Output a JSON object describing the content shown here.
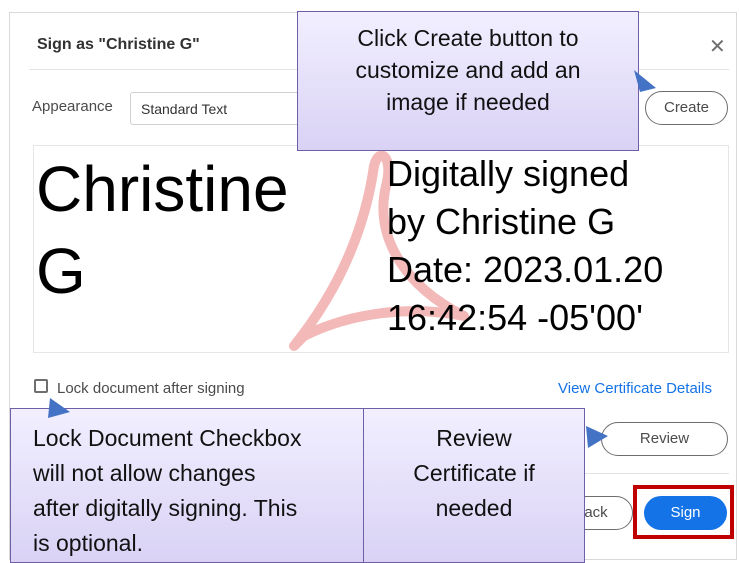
{
  "dialog": {
    "title": "Sign as \"Christine G\"",
    "close_icon": "close-icon"
  },
  "appearance": {
    "label": "Appearance",
    "selected": "Standard Text"
  },
  "buttons": {
    "create": "Create",
    "review": "Review",
    "back": "ack",
    "sign": "Sign"
  },
  "preview": {
    "name": "Christine G",
    "details": [
      "Digitally signed",
      "by Christine G",
      "Date: 2023.01.20",
      "16:42:54 -05'00'"
    ]
  },
  "lock": {
    "label": "Lock document after signing",
    "checked": false
  },
  "links": {
    "view_certificate": "View Certificate Details"
  },
  "callouts": {
    "create": [
      "Click Create button to",
      "customize and add an",
      "image if needed"
    ],
    "lock": [
      "Lock Document Checkbox",
      "will not allow changes",
      "after digitally signing. This",
      "is optional."
    ],
    "review": [
      "Review",
      "Certificate if",
      "needed"
    ]
  },
  "colors": {
    "accent": "#1473e6",
    "highlight": "#c00000",
    "callout_border": "#6e5fa6",
    "arrow": "#4472c4"
  }
}
